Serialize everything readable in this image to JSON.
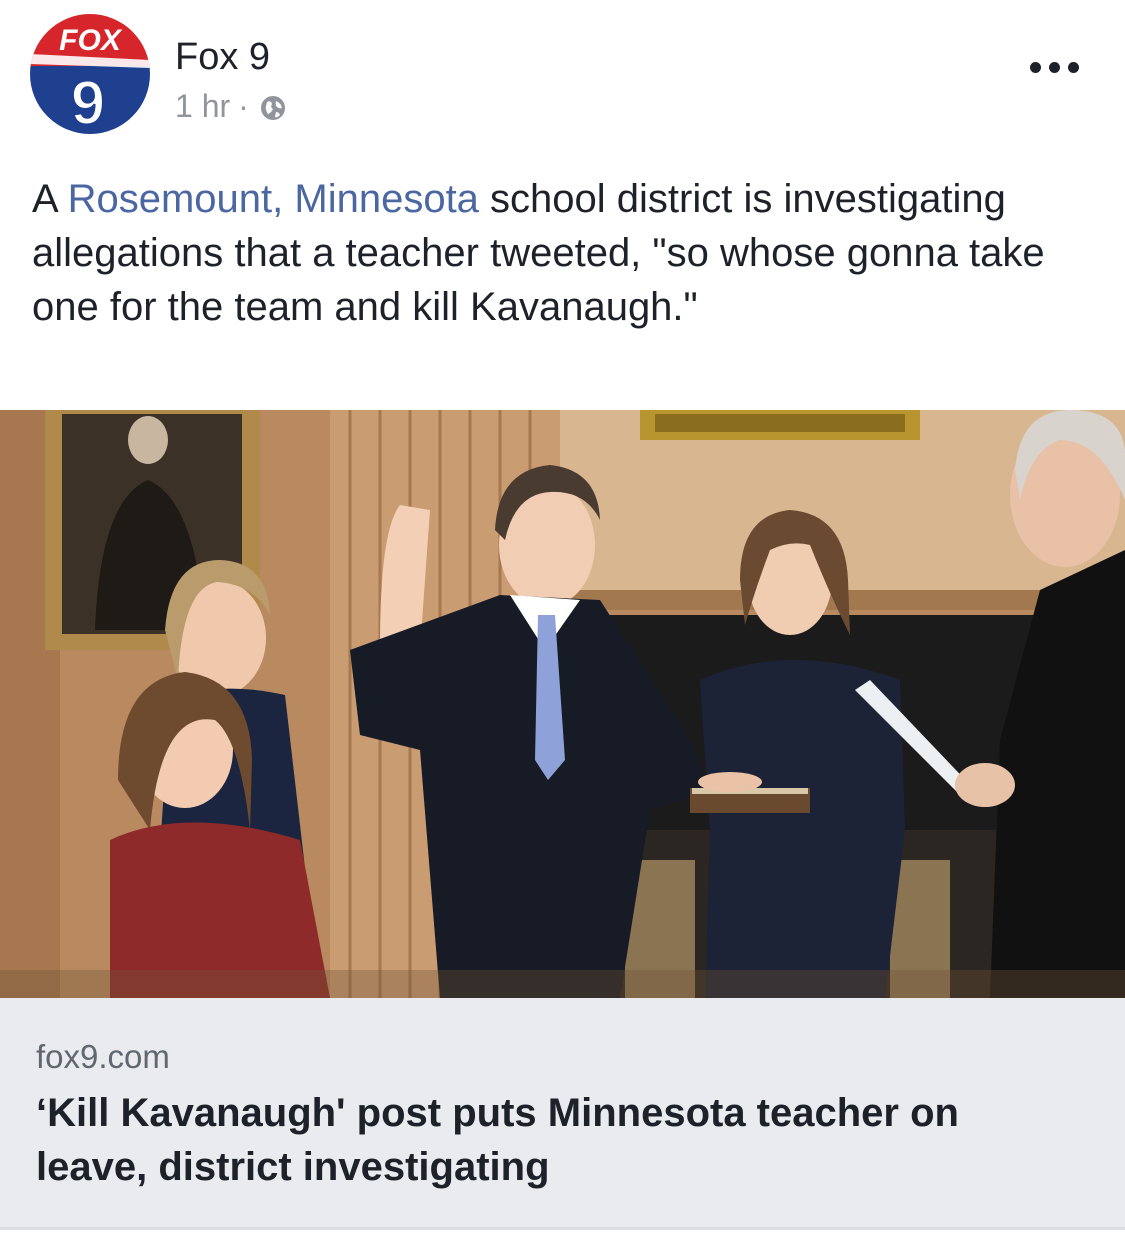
{
  "post": {
    "page_name": "Fox 9",
    "time": "1 hr",
    "separator": "·",
    "privacy_icon": "globe-icon",
    "more_icon": "more-options-icon",
    "text_before": "A ",
    "text_link": "Rosemount, Minnesota",
    "text_after": " school district is investigating allegations that a teacher tweeted, \"so whose gonna take one for the team and kill Kavanaugh.\""
  },
  "avatar": {
    "logo_text": "FOX",
    "logo_number": "9",
    "colors": {
      "red": "#d7262b",
      "blue": "#1f3f8f",
      "white": "#ffffff"
    }
  },
  "link_preview": {
    "domain": "fox9.com",
    "headline": "‘Kill Kavanaugh' post puts Minnesota teacher on leave, district investigating"
  },
  "colors": {
    "link": "#4b67a1",
    "meta": "#90949c",
    "preview_bg": "#e9ebee"
  }
}
